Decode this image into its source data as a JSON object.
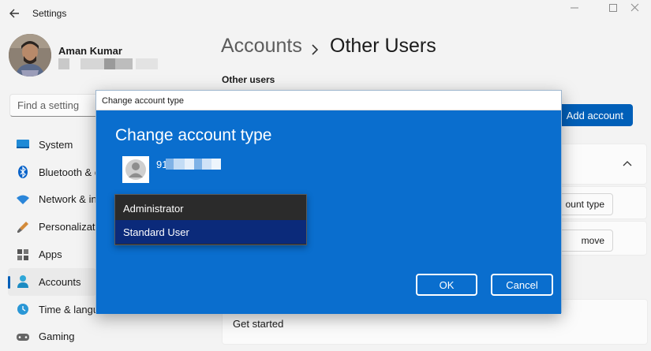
{
  "window": {
    "title": "Settings"
  },
  "profile": {
    "name": "Aman Kumar"
  },
  "search": {
    "placeholder": "Find a setting"
  },
  "nav": [
    {
      "label": "System",
      "icon": "system-icon"
    },
    {
      "label": "Bluetooth & d",
      "icon": "bluetooth-icon"
    },
    {
      "label": "Network & in",
      "icon": "wifi-icon"
    },
    {
      "label": "Personalizatio",
      "icon": "brush-icon"
    },
    {
      "label": "Apps",
      "icon": "apps-icon"
    },
    {
      "label": "Accounts",
      "icon": "person-icon",
      "active": true
    },
    {
      "label": "Time & langua",
      "icon": "clock-icon"
    },
    {
      "label": "Gaming",
      "icon": "controller-icon"
    }
  ],
  "breadcrumb": {
    "parent": "Accounts",
    "current": "Other Users"
  },
  "main": {
    "section_label": "Other users",
    "add_account": "Add account",
    "change_type_partial": "ount type",
    "remove_partial": "move",
    "get_started": "Get started"
  },
  "dialog": {
    "window_title": "Change account type",
    "heading": "Change account type",
    "username_prefix": "91",
    "options": [
      "Administrator",
      "Standard User"
    ],
    "selected": "Standard User",
    "ok": "OK",
    "cancel": "Cancel"
  },
  "colors": {
    "accent": "#005fb8",
    "dialog_bg": "#0a6ece",
    "selected_option": "#0b2a7a"
  }
}
